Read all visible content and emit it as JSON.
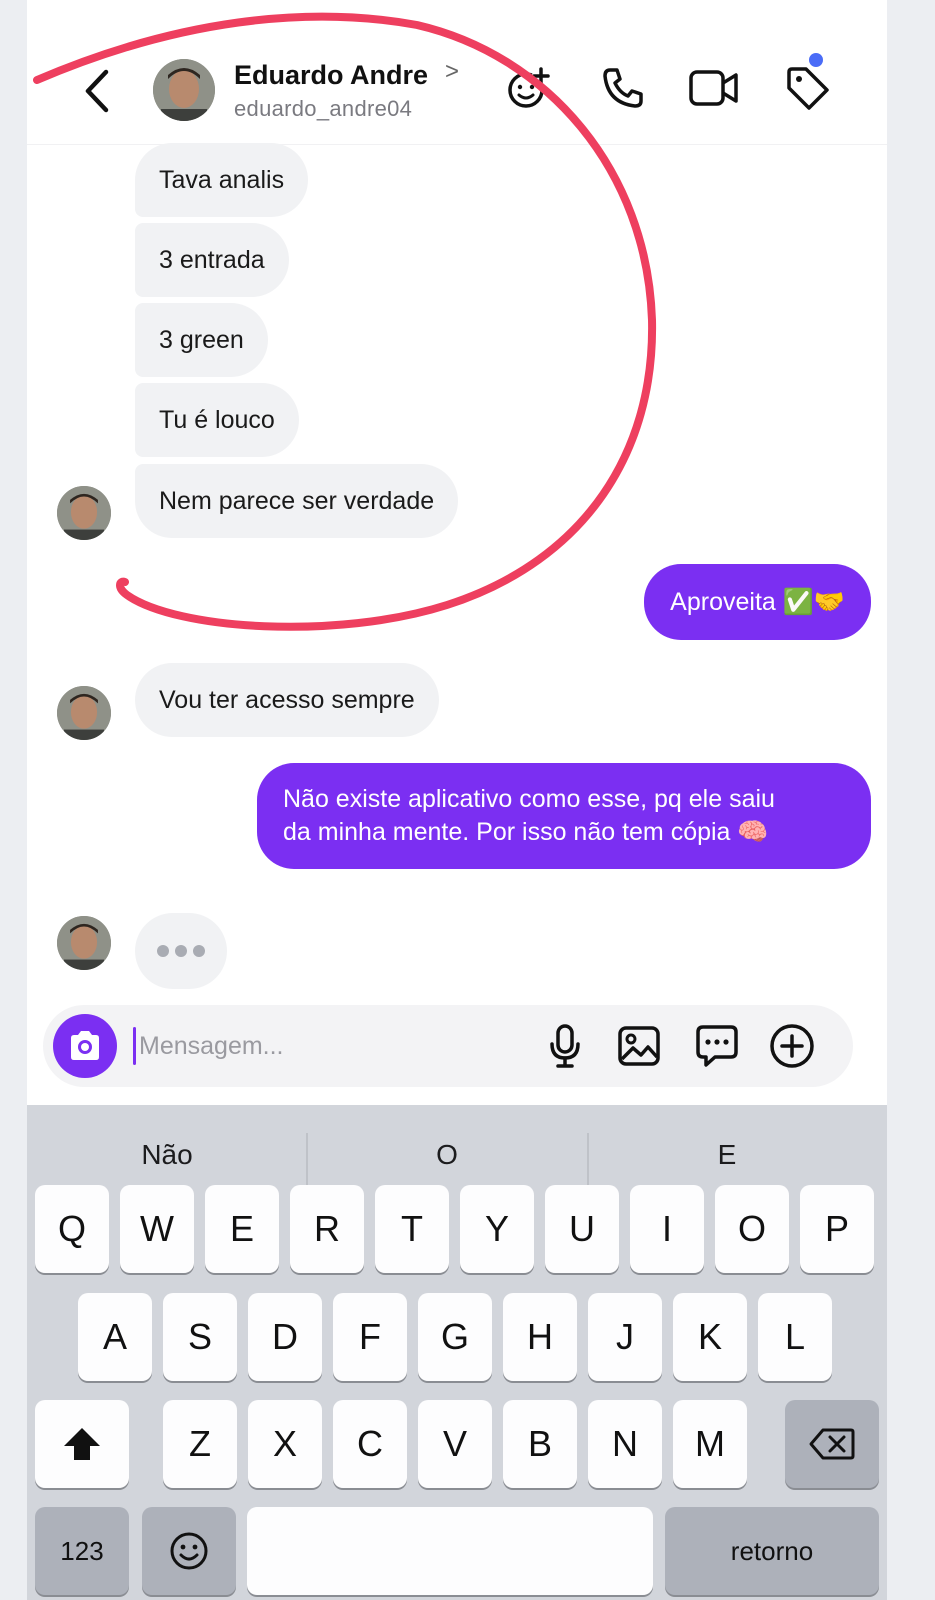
{
  "header": {
    "contact_name": "Eduardo Andre",
    "contact_handle": "eduardo_andre04",
    "chevron": ">",
    "icons": [
      "back-icon",
      "add-reaction-icon",
      "phone-icon",
      "video-icon",
      "tag-icon"
    ],
    "notification_dot_color": "#4a6cf7"
  },
  "messages": {
    "incoming_group_1": [
      "Tava analis",
      "3 entrada",
      "3 green",
      "Tu é louco",
      "Nem parece ser verdade"
    ],
    "outgoing_1": "Aproveita ✅🤝",
    "incoming_2": "Vou ter acesso sempre",
    "outgoing_2_line1": "Não existe aplicativo como esse, pq ele saiu",
    "outgoing_2_line2": "da minha mente. Por isso não tem cópia 🧠"
  },
  "composer": {
    "placeholder": "Mensagem...",
    "icons": [
      "camera-icon",
      "microphone-icon",
      "gallery-icon",
      "chat-bubble-icon",
      "plus-circle-icon"
    ]
  },
  "keyboard": {
    "suggestions": [
      "Não",
      "O",
      "E"
    ],
    "row1": [
      "Q",
      "W",
      "E",
      "R",
      "T",
      "Y",
      "U",
      "I",
      "O",
      "P"
    ],
    "row2": [
      "A",
      "S",
      "D",
      "F",
      "G",
      "H",
      "J",
      "K",
      "L"
    ],
    "row3": [
      "Z",
      "X",
      "C",
      "V",
      "B",
      "N",
      "M"
    ],
    "numbers_key": "123",
    "return_key": "retorno"
  },
  "colors": {
    "accent": "#7b2ff2",
    "annotation": "#ee3f5f",
    "incoming_bubble": "#f1f2f4"
  }
}
